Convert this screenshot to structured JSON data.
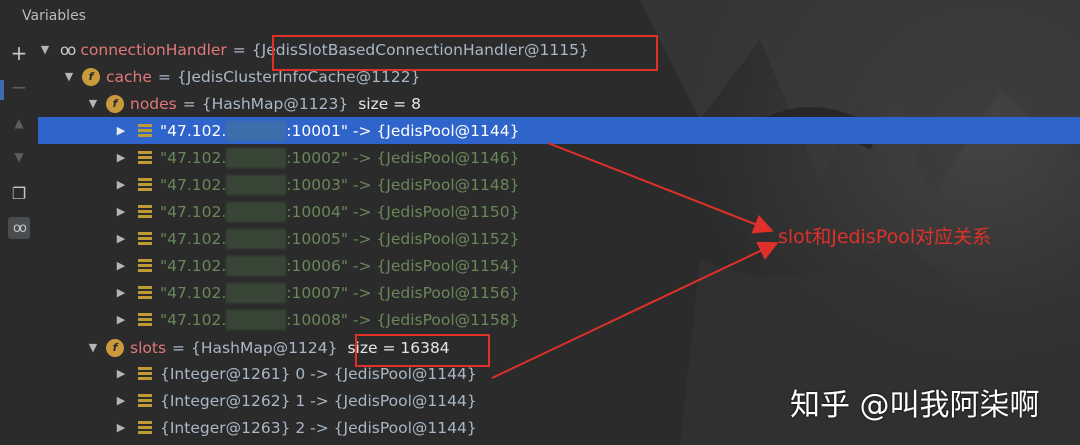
{
  "panel": {
    "title": "Variables"
  },
  "toolbar": {
    "buttons": [
      "add",
      "remove",
      "move-up",
      "move-down",
      "copy",
      "watch"
    ]
  },
  "tree": {
    "root": {
      "name": "connectionHandler",
      "op": "=",
      "value": "{JedisSlotBasedConnectionHandler@1115}"
    },
    "cache": {
      "name": "cache",
      "op": "=",
      "value": "{JedisClusterInfoCache@1122}"
    },
    "nodes": {
      "name": "nodes",
      "op": "=",
      "value": "{HashMap@1123}",
      "size": "size = 8"
    },
    "node_rows": [
      {
        "prefix": "\"47.102.",
        "suffix": ":10001\" -> {JedisPool@1144}"
      },
      {
        "prefix": "\"47.102.",
        "suffix": ":10002\" -> {JedisPool@1146}"
      },
      {
        "prefix": "\"47.102.",
        "suffix": ":10003\" -> {JedisPool@1148}"
      },
      {
        "prefix": "\"47.102.",
        "suffix": ":10004\" -> {JedisPool@1150}"
      },
      {
        "prefix": "\"47.102.",
        "suffix": ":10005\" -> {JedisPool@1152}"
      },
      {
        "prefix": "\"47.102.",
        "suffix": ":10006\" -> {JedisPool@1154}"
      },
      {
        "prefix": "\"47.102.",
        "suffix": ":10007\" -> {JedisPool@1156}"
      },
      {
        "prefix": "\"47.102.",
        "suffix": ":10008\" -> {JedisPool@1158}"
      }
    ],
    "slots": {
      "name": "slots",
      "op": "=",
      "value": "{HashMap@1124}",
      "size": "size = 16384"
    },
    "slot_rows": [
      {
        "text": "{Integer@1261} 0 -> {JedisPool@1144}"
      },
      {
        "text": "{Integer@1262} 1 -> {JedisPool@1144}"
      },
      {
        "text": "{Integer@1263} 2 -> {JedisPool@1144}"
      }
    ]
  },
  "annotation": "slot和JedisPool对应关系",
  "watermark": "知乎 @叫我阿柒啊",
  "colors": {
    "selection": "#2f65ca",
    "annotation": "#e0302a",
    "name": "#e07878",
    "string": "#6a8759"
  }
}
